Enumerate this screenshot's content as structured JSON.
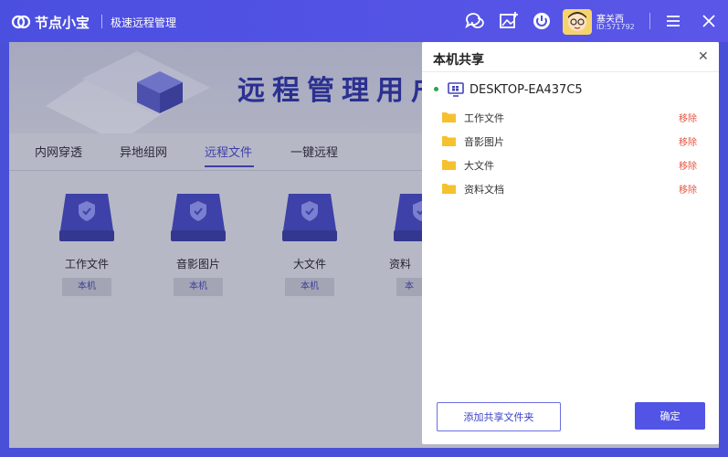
{
  "app": {
    "name": "节点小宝",
    "subtitle": "极速远程管理"
  },
  "user": {
    "name": "塞关西",
    "id": "ID:571792"
  },
  "banner": {
    "title": "远程管理用户"
  },
  "tabs": [
    {
      "label": "内网穿透"
    },
    {
      "label": "异地组网"
    },
    {
      "label": "远程文件",
      "active": true
    },
    {
      "label": "一键远程"
    }
  ],
  "drives": [
    {
      "label": "工作文件",
      "badge": "本机"
    },
    {
      "label": "音影图片",
      "badge": "本机"
    },
    {
      "label": "大文件",
      "badge": "本机"
    },
    {
      "label": "资料",
      "badge": "本"
    }
  ],
  "dialog": {
    "title": "本机共享",
    "close": "✕",
    "device": "DESKTOP-EA437C5",
    "folders": [
      {
        "name": "工作文件",
        "action": "移除"
      },
      {
        "name": "音影图片",
        "action": "移除"
      },
      {
        "name": "大文件",
        "action": "移除"
      },
      {
        "name": "资料文档",
        "action": "移除"
      }
    ],
    "add_button": "添加共享文件夹",
    "ok_button": "确定"
  },
  "colors": {
    "accent": "#5254e6",
    "danger": "#e5533f",
    "online": "#2ea44f"
  },
  "icons": [
    "chat-icon",
    "image-add-icon",
    "power-icon",
    "menu-icon",
    "close-icon",
    "folder-icon",
    "computer-icon"
  ]
}
